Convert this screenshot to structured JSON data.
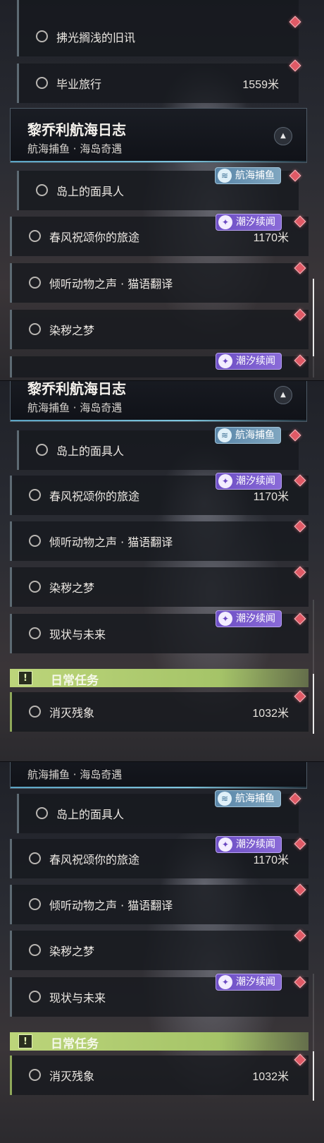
{
  "quests": {
    "prev_1": "拂光搁浅的旧讯",
    "prev_2": "毕业旅行",
    "prev_2_distance": "1559米",
    "group_title": "黎乔利航海日志",
    "group_subtitle": "航海捕鱼 · 海岛奇遇",
    "items": [
      {
        "label": "岛上的面具人"
      },
      {
        "label": "春风祝颂你的旅途",
        "distance": "1170米"
      },
      {
        "label": "倾听动物之声 · 猫语翻译"
      },
      {
        "label": "染秽之梦"
      },
      {
        "label": "现状与未来"
      }
    ],
    "tag_fishing": "航海捕鱼",
    "tag_tide": "潮汐续闻",
    "collapse_icon": "chevron-up-icon"
  },
  "daily": {
    "section_title": "日常任务",
    "icon": "alert-icon",
    "item_label": "消灭残象",
    "item_distance": "1032米"
  },
  "colors": {
    "marker": "#e05a66",
    "daily_bar": "#bcd57a",
    "tide_tag": "#7a5bcf",
    "fishing_tag": "#6f98b6"
  }
}
